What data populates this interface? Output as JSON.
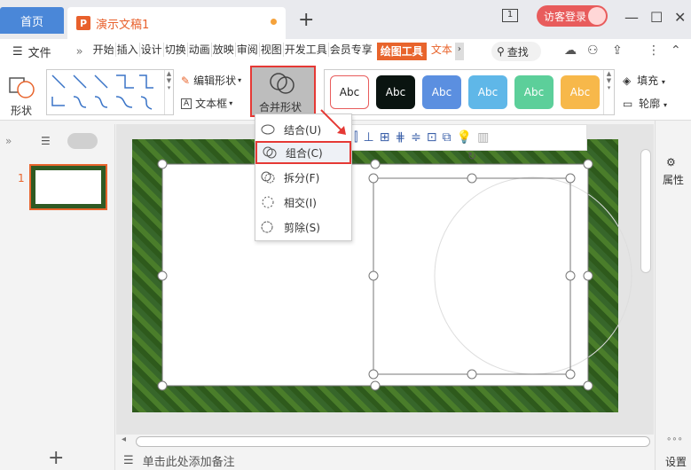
{
  "titlebar": {
    "home_tab": "首页",
    "doc_tab_icon": "P",
    "doc_tab_title": "演示文稿1",
    "page_icon_number": "1",
    "visitor_label": "访客登录",
    "win_minimize": "—",
    "win_maximize": "☐",
    "win_close": "✕",
    "add_tab": "+"
  },
  "menubar": {
    "file": "文件",
    "more": "»",
    "items": [
      "开始",
      "插入",
      "设计",
      "切换",
      "动画",
      "放映",
      "审阅",
      "视图",
      "开发工具",
      "会员专享"
    ],
    "active_item": "绘图工具",
    "text_tool": "文本",
    "search": "查找"
  },
  "ribbon": {
    "shape_label": "形状",
    "edit_shape": "编辑形状",
    "text_box": "文本框",
    "merge_shape": "合并形状",
    "style_items": [
      {
        "label": "Abc",
        "bg": "#ffffff",
        "fg": "#222222",
        "border": "#e85c5c"
      },
      {
        "label": "Abc",
        "bg": "#0a1410",
        "fg": "#ffffff",
        "border": "#0a1410"
      },
      {
        "label": "Abc",
        "bg": "#5b8fe0",
        "fg": "#ffffff",
        "border": "#4a7dd0"
      },
      {
        "label": "Abc",
        "bg": "#5fb7e8",
        "fg": "#ffffff",
        "border": "#4aa5d8"
      },
      {
        "label": "Abc",
        "bg": "#5ccf9a",
        "fg": "#ffffff",
        "border": "#48be88"
      },
      {
        "label": "Abc",
        "bg": "#f7b84a",
        "fg": "#ffffff",
        "border": "#eaa636"
      }
    ],
    "fill": "填充",
    "outline": "轮廓"
  },
  "dropdown": {
    "items": [
      "结合(U)",
      "组合(C)",
      "拆分(F)",
      "相交(I)",
      "剪除(S)"
    ],
    "highlighted_index": 1
  },
  "left_panel": {
    "slide_number": "1",
    "add_slide": "+"
  },
  "right_panel": {
    "properties": "属性"
  },
  "bottom": {
    "notes_placeholder": "单击此处添加备注",
    "settings": "设置"
  }
}
